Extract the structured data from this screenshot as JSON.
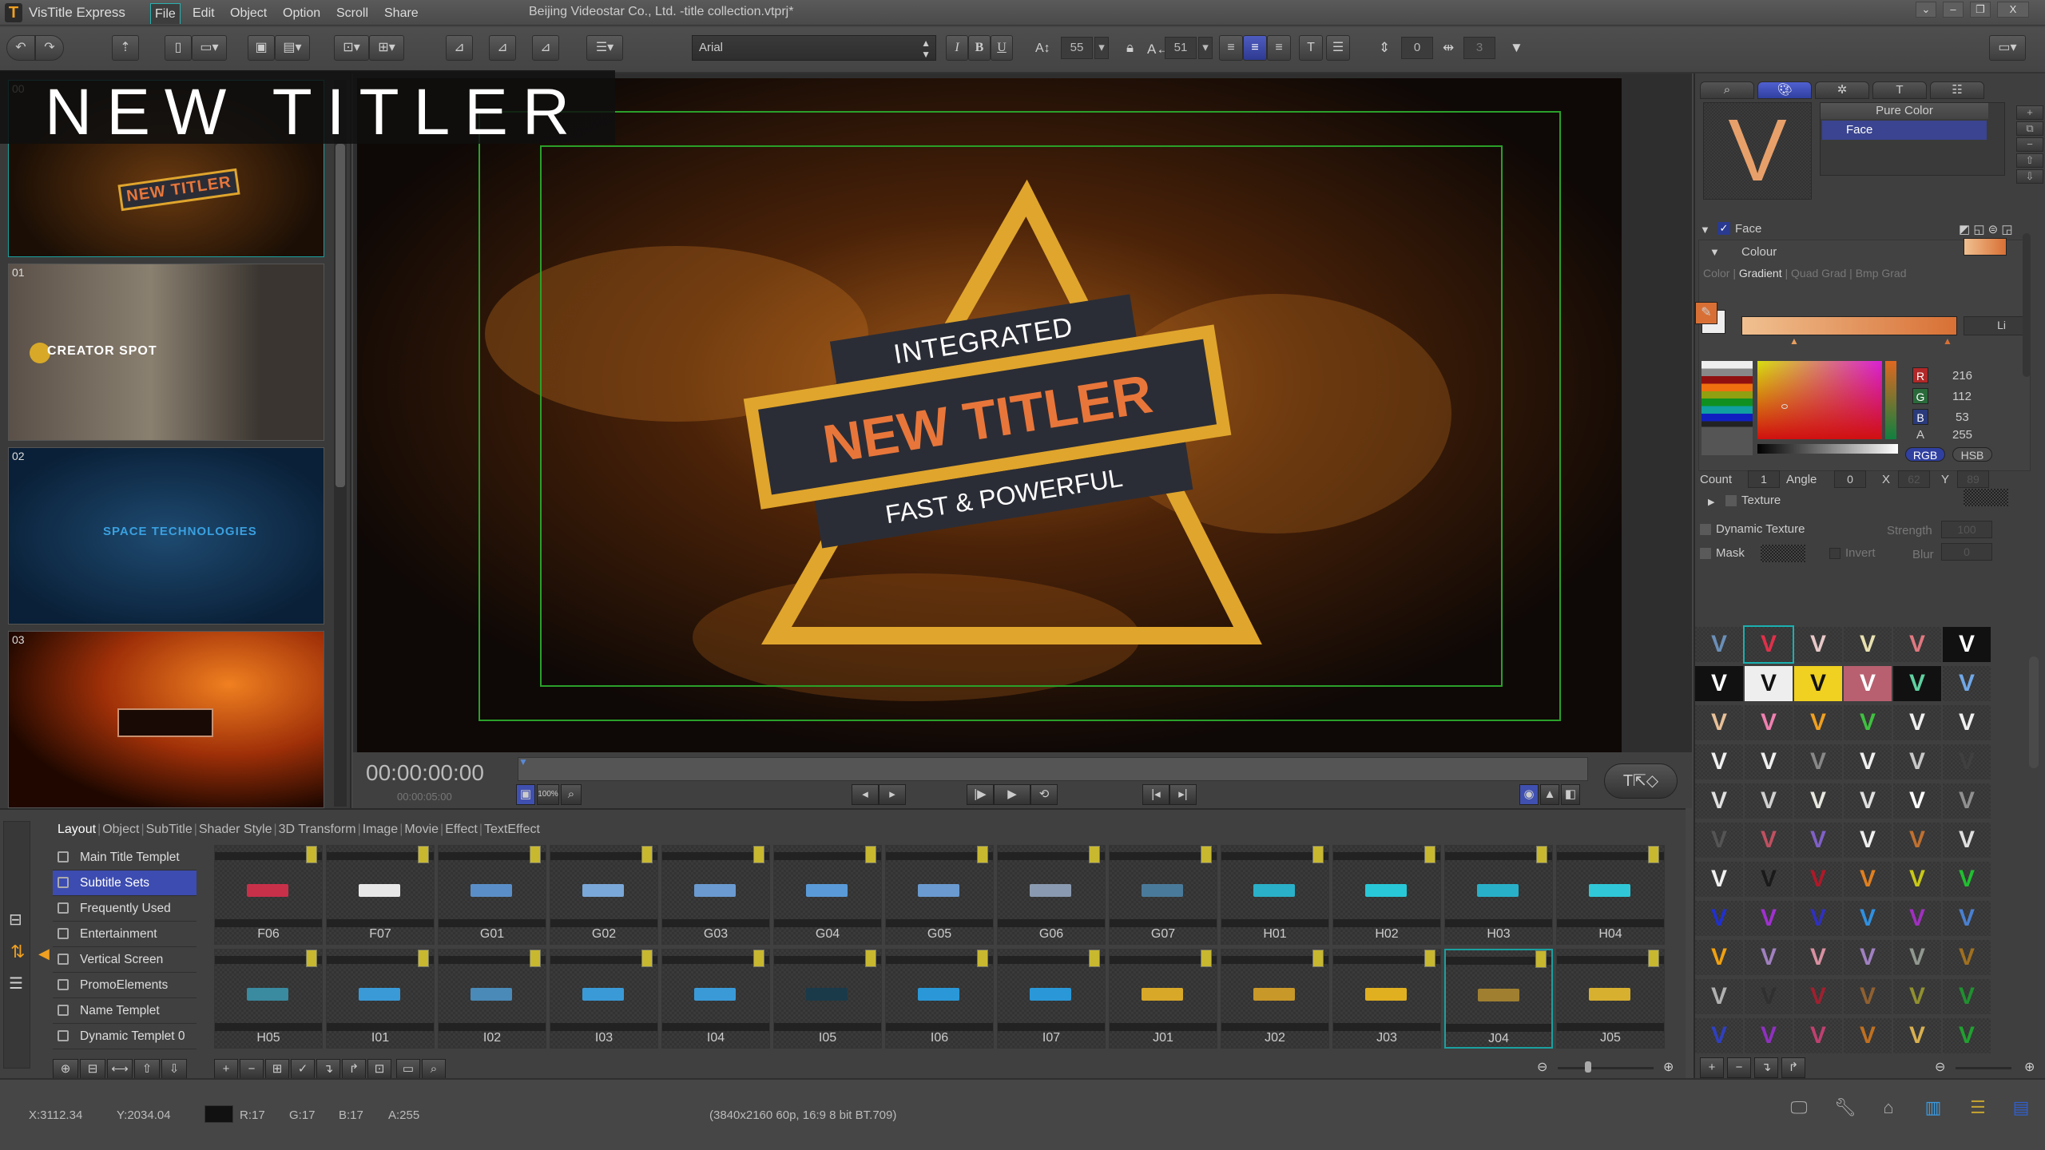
{
  "app": {
    "name": "VisTitle Express",
    "logo_letter": "T",
    "document_title": "Beijing Videostar Co., Ltd. -title collection.vtprj*"
  },
  "menu": [
    "File",
    "Edit",
    "Object",
    "Option",
    "Scroll",
    "Share"
  ],
  "window_buttons": [
    "⌄",
    "–",
    "❐",
    "X"
  ],
  "toolbar": {
    "font": "Arial",
    "italic": "I",
    "bold": "B",
    "underline": "U",
    "font_size": "55",
    "tracking": "51",
    "spacing": "0",
    "leading": "3",
    "align_selected": "center"
  },
  "thumbnails": [
    {
      "num": "00",
      "caption": "NEW TITLER"
    },
    {
      "num": "01",
      "caption": "CREATOR SPOT"
    },
    {
      "num": "02",
      "caption": "SPACE TECHNOLOGIES"
    },
    {
      "num": "03",
      "caption": ""
    }
  ],
  "overlay_banner": "NEW TITLER",
  "canvas": {
    "line1": "INTEGRATED",
    "line2": "NEW TITLER",
    "line3": "FAST & POWERFUL",
    "accent": "#e0a52c",
    "banner": "#2b2d36",
    "title_color": "#e8763a"
  },
  "transport": {
    "timecode": "00:00:00:00",
    "duration": "00:00:05:00",
    "zoom_label": "100%"
  },
  "bottom": {
    "tabs": [
      "Layout",
      "Object",
      "SubTitle",
      "Shader Style",
      "3D Transform",
      "Image",
      "Movie",
      "Effect",
      "TextEffect"
    ],
    "categories": [
      "Main Title Templet",
      "Subtitle Sets",
      "Frequently Used",
      "Entertainment",
      "Vertical Screen",
      "PromoElements",
      "Name Templet",
      "Dynamic Templet 0"
    ],
    "selected_category": "Subtitle Sets",
    "templates": [
      {
        "label": "F06",
        "color": "#c8304a"
      },
      {
        "label": "F07",
        "color": "#e8e8e8"
      },
      {
        "label": "G01",
        "color": "#5a8ec8"
      },
      {
        "label": "G02",
        "color": "#7aa8d8"
      },
      {
        "label": "G03",
        "color": "#6a9ad0"
      },
      {
        "label": "G04",
        "color": "#5a9ad8"
      },
      {
        "label": "G05",
        "color": "#6a9ad0"
      },
      {
        "label": "G06",
        "color": "#8a9ab0"
      },
      {
        "label": "G07",
        "color": "#4a7a9a"
      },
      {
        "label": "H01",
        "color": "#2ab0c8"
      },
      {
        "label": "H02",
        "color": "#28c8d8"
      },
      {
        "label": "H03",
        "color": "#28b0c8"
      },
      {
        "label": "H04",
        "color": "#30c8d8"
      },
      {
        "label": "H05",
        "color": "#3a8aa0"
      },
      {
        "label": "I01",
        "color": "#3a9ad8"
      },
      {
        "label": "I02",
        "color": "#4a8ab8"
      },
      {
        "label": "I03",
        "color": "#3a9ad8"
      },
      {
        "label": "I04",
        "color": "#3a9ad8"
      },
      {
        "label": "I05",
        "color": "#1a3a4a"
      },
      {
        "label": "I06",
        "color": "#2a98d8"
      },
      {
        "label": "I07",
        "color": "#2a98d8"
      },
      {
        "label": "J01",
        "color": "#d8a828"
      },
      {
        "label": "J02",
        "color": "#c89828"
      },
      {
        "label": "J03",
        "color": "#e0b020"
      },
      {
        "label": "J04",
        "color": "#a08030"
      },
      {
        "label": "J05",
        "color": "#d8b030"
      }
    ],
    "selected_template": "J04"
  },
  "style_panel": {
    "tabs": [
      "search",
      "palette",
      "magic-wand",
      "text",
      "layers"
    ],
    "layer_type": "Pure Color",
    "layer_name": "Face",
    "face_label": "Face",
    "face_checked": true,
    "colour_label": "Colour",
    "fill_modes": [
      "Color",
      "Gradient",
      "Quad Grad",
      "Bmp Grad"
    ],
    "fill_mode_selected": "Gradient",
    "gradient": {
      "from": "#f0c090",
      "to": "#d87035",
      "type": "Li"
    },
    "rgba": {
      "R": "216",
      "G": "112",
      "B": "53",
      "A": "255"
    },
    "mode_buttons": [
      "RGB",
      "HSB"
    ],
    "count_label": "Count",
    "count": "1",
    "angle_label": "Angle",
    "angle": "0",
    "x_label": "X",
    "x": "62",
    "y_label": "Y",
    "y": "89",
    "texture_label": "Texture",
    "dynamic_texture_label": "Dynamic Texture",
    "strength_label": "Strength",
    "strength": "100",
    "mask_label": "Mask",
    "invert_label": "Invert",
    "blur_label": "Blur",
    "blur": "0",
    "presets": [
      "#6a8fb8",
      "#e0304a",
      "#e8c8c8",
      "#e8e0b0",
      "#e07880",
      "#ffffff",
      "#ffffff",
      "#111111",
      "#111111",
      "#ffffff",
      "#60d0a0",
      "#70a8e8",
      "#e8c098",
      "#f080b0",
      "#f0a020",
      "#40c040",
      "#f0f0f0",
      "#f0f0f0",
      "#f0f0f0",
      "#f0f0f0",
      "#888888",
      "#f0f0f0",
      "#c8c8c8",
      "#404040",
      "#e0e0e0",
      "#d0d0d0",
      "#e8e8e0",
      "#e0e0e0",
      "#ffffff",
      "#909090",
      "#555555",
      "#c05060",
      "#8060c8",
      "#f0f0f0",
      "#c07030",
      "#e0e0e0",
      "#f0f0f0",
      "#1a1a1a",
      "#b01828",
      "#e08020",
      "#c8c818",
      "#20c030",
      "#2030d0",
      "#a030d0",
      "#3030c0",
      "#3090e0",
      "#a030c0",
      "#4a80d0",
      "#f0a010",
      "#a080c0",
      "#d890a0",
      "#a080c0",
      "#909890",
      "#a07020",
      "#b0b0b0",
      "#303030",
      "#a02030",
      "#906030",
      "#909030",
      "#209030",
      "#3040c0",
      "#9030c0",
      "#c04070",
      "#c07020",
      "#d8b050",
      "#20a030"
    ],
    "selected_preset": 1
  },
  "status": {
    "x": "X:3112.34",
    "y": "Y:2034.04",
    "r": "R:17",
    "g": "G:17",
    "b": "B:17",
    "a": "A:255",
    "swatch": "#111111",
    "format": "(3840x2160 60p, 16:9 8 bit BT.709)"
  }
}
